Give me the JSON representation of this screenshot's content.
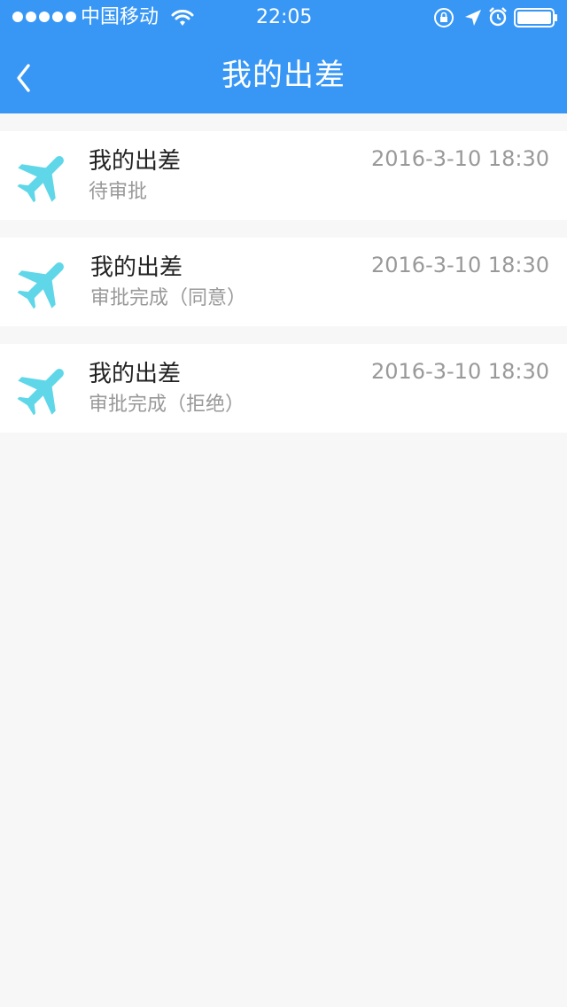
{
  "status_bar": {
    "carrier": "中国移动",
    "time": "22:05",
    "icons": [
      "signal-dots-icon",
      "wifi-icon",
      "rotation-lock-icon",
      "location-arrow-icon",
      "alarm-icon",
      "battery-icon"
    ]
  },
  "nav": {
    "title": "我的出差",
    "back_icon": "chevron-left-icon"
  },
  "trips": [
    {
      "icon": "airplane-icon",
      "title": "我的出差",
      "status": "待审批",
      "time": "2016-3-10 18:30"
    },
    {
      "icon": "airplane-icon",
      "title": "我的出差",
      "status": "审批完成（同意）",
      "time": "2016-3-10 18:30"
    },
    {
      "icon": "airplane-icon",
      "title": "我的出差",
      "status": "审批完成（拒绝）",
      "time": "2016-3-10 18:30"
    }
  ],
  "colors": {
    "header": "#3897f5",
    "icon_accent": "#5fd7e9",
    "background": "#f7f7f7",
    "primary_text": "#222222",
    "secondary_text": "#999999"
  }
}
